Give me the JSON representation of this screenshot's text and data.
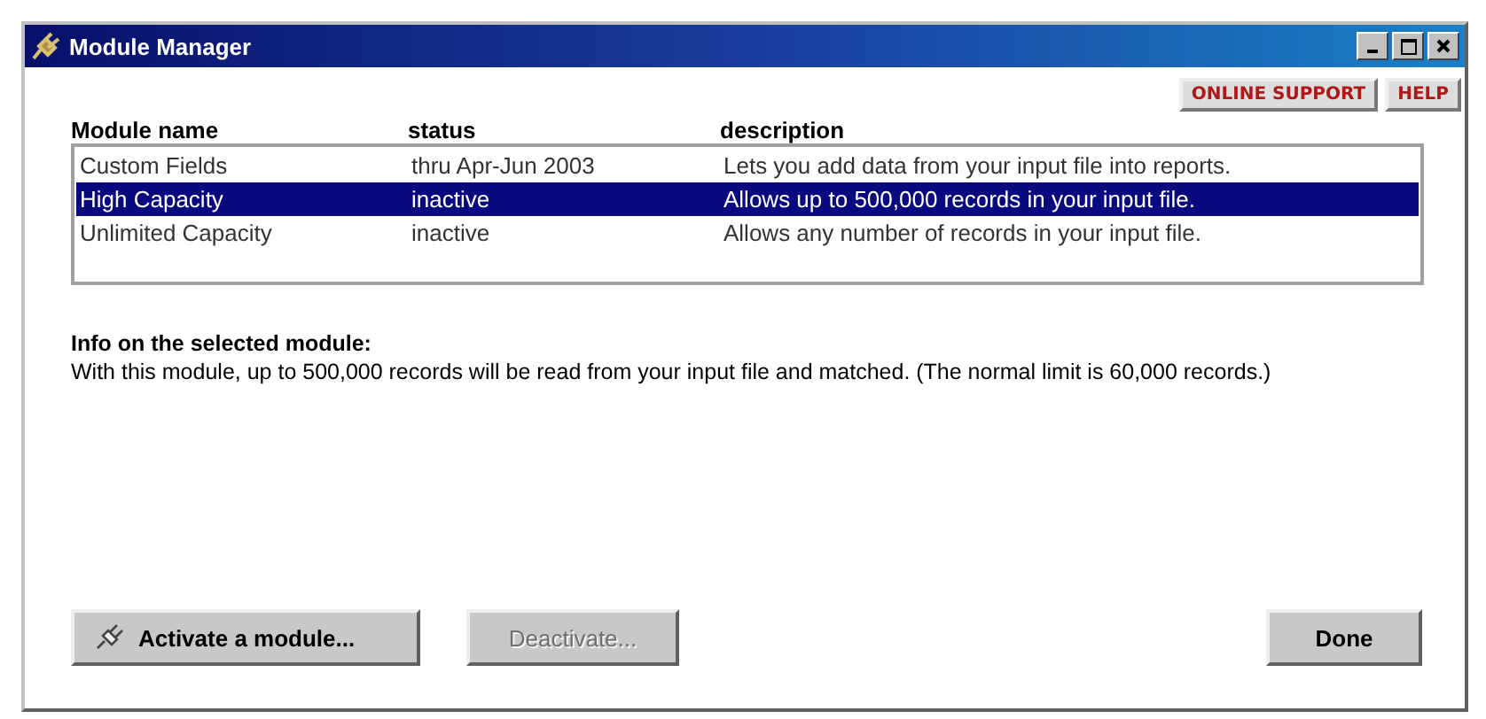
{
  "window": {
    "title": "Module Manager"
  },
  "help_buttons": [
    "ONLINE SUPPORT",
    "HELP"
  ],
  "table": {
    "columns": [
      "Module name",
      "status",
      "description"
    ],
    "rows": [
      {
        "name": "Custom Fields",
        "status": "thru Apr-Jun 2003",
        "description": "Lets you add data from your input file into reports.",
        "selected": false
      },
      {
        "name": "High Capacity",
        "status": "inactive",
        "description": "Allows up to 500,000 records in your input file.",
        "selected": true
      },
      {
        "name": "Unlimited Capacity",
        "status": "inactive",
        "description": "Allows any number of records in your input file.",
        "selected": false
      }
    ]
  },
  "info": {
    "heading": "Info on the selected module:",
    "text": "With this module, up to 500,000 records will be read from your input file and matched.  (The normal limit is 60,000 records.)"
  },
  "buttons": [
    {
      "label": "Activate a module...",
      "disabled": false,
      "kind": "activate"
    },
    {
      "label": "Deactivate...",
      "disabled": true,
      "kind": "deactivate"
    },
    {
      "label": "Done",
      "disabled": false,
      "kind": "done"
    }
  ]
}
